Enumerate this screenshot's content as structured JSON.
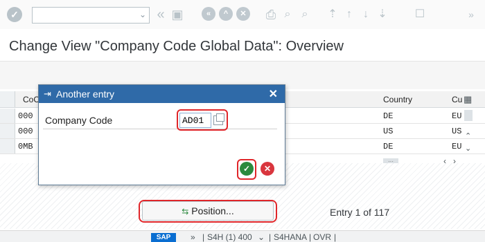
{
  "toolbar": {
    "ok_icon": "check-circle-icon",
    "command_value": "",
    "icons": [
      "back-icon",
      "save-icon",
      "back-nav-icon",
      "exit-icon",
      "cancel-icon",
      "print-icon",
      "find-icon",
      "find-next-icon",
      "first-page-icon",
      "prev-page-icon",
      "next-page-icon",
      "last-page-icon",
      "new-session-icon"
    ],
    "overflow": "»"
  },
  "title": "Change View \"Company Code Global Data\": Overview",
  "table": {
    "columns": {
      "company_code": "CoC",
      "country": "Country",
      "currency": "Cu"
    },
    "rows": [
      {
        "company_code": "000",
        "country": "DE",
        "currency": "EU"
      },
      {
        "company_code": "000",
        "country": "US",
        "currency": "US"
      },
      {
        "company_code": "0MB",
        "country": "DE",
        "currency": "EU"
      }
    ]
  },
  "dialog": {
    "title": "Another entry",
    "field_label": "Company Code",
    "field_value": "AD01",
    "close_icon": "close-icon",
    "ok_icon": "check-circle-icon",
    "cancel_icon": "cancel-circle-icon"
  },
  "position_button": "Position...",
  "entry_info": "Entry 1 of 117",
  "status_bar": {
    "logo": "SAP",
    "system": "S4H (1) 400",
    "server": "S4HANA",
    "mode": "OVR"
  },
  "colors": {
    "dialog_title": "#2f6aa8",
    "highlight": "#e0262a",
    "ok_green": "#2b8a3e",
    "cancel_red": "#d9363e"
  }
}
